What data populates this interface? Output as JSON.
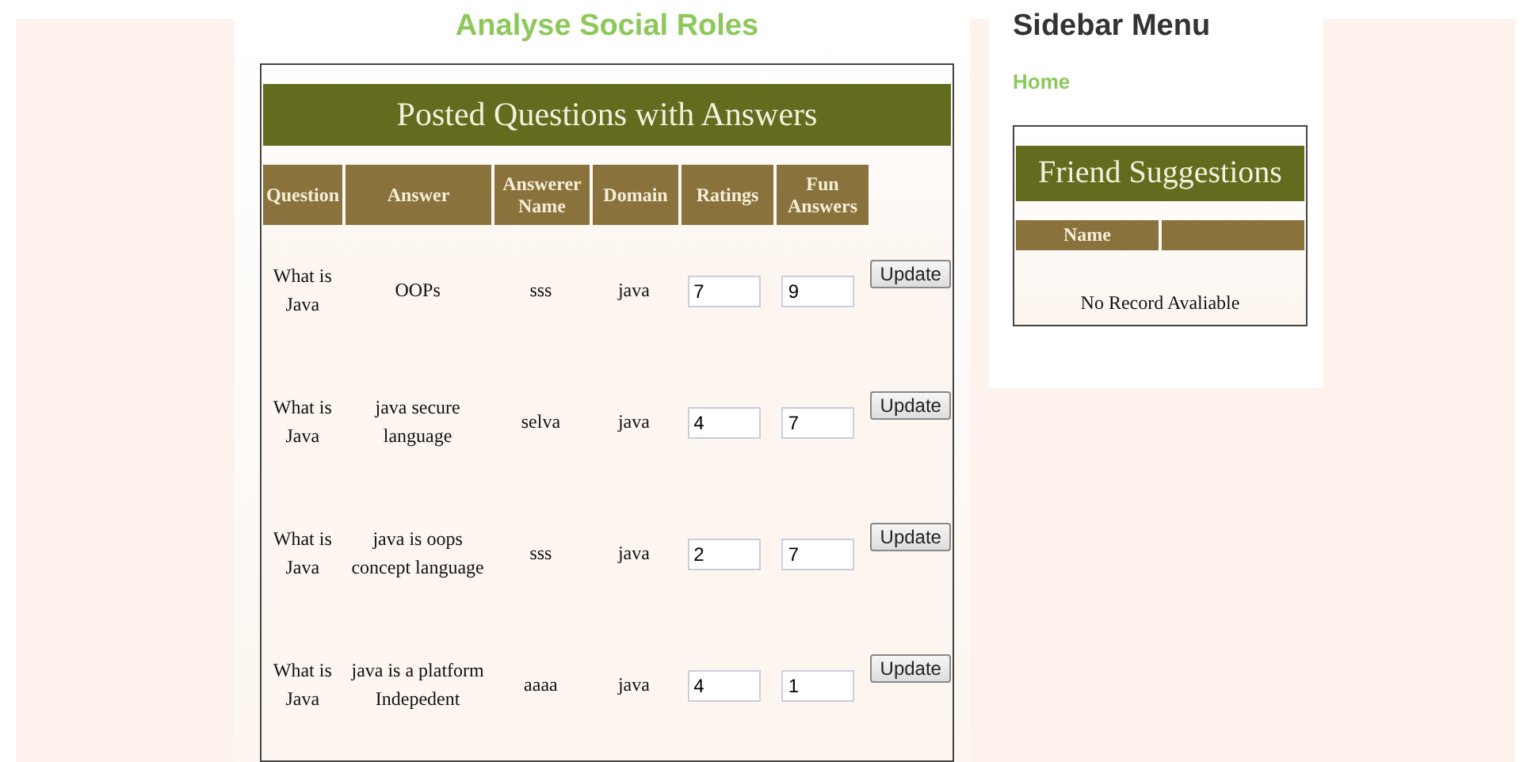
{
  "main": {
    "title": "Analyse Social Roles",
    "table": {
      "caption": "Posted Questions with Answers",
      "columns": [
        "Question",
        "Answer",
        "Answerer Name",
        "Domain",
        "Ratings",
        "Fun Answers"
      ],
      "rows": [
        {
          "question": "What is Java",
          "answer": "OOPs",
          "answerer": "sss",
          "domain": "java",
          "rating": "7",
          "fun": "9",
          "button": "Update"
        },
        {
          "question": "What is Java",
          "answer": "java secure language",
          "answerer": "selva",
          "domain": "java",
          "rating": "4",
          "fun": "7",
          "button": "Update"
        },
        {
          "question": "What is Java",
          "answer": "java is oops concept language",
          "answerer": "sss",
          "domain": "java",
          "rating": "2",
          "fun": "7",
          "button": "Update"
        },
        {
          "question": "What is Java",
          "answer": "java is a platform Indepedent",
          "answerer": "aaaa",
          "domain": "java",
          "rating": "4",
          "fun": "1",
          "button": "Update"
        }
      ]
    }
  },
  "sidebar": {
    "title": "Sidebar Menu",
    "links": [
      "Home"
    ],
    "friends": {
      "caption": "Friend Suggestions",
      "columns": [
        "Name"
      ],
      "empty": "No Record Avaliable"
    }
  }
}
